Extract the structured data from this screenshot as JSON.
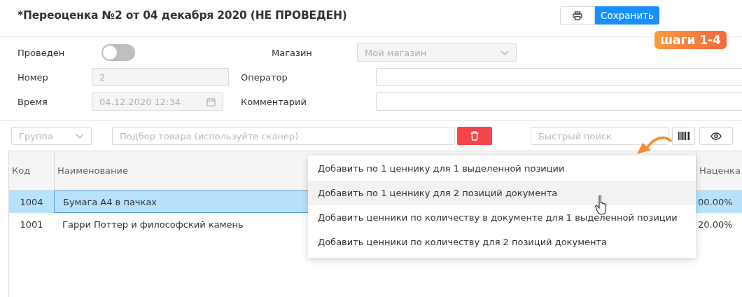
{
  "title": "*Переоценка №2 от 04 декабря 2020 (НЕ ПРОВЕДЕН)",
  "header_buttons": {
    "save": "Сохранить"
  },
  "badge": "шаги 1-4",
  "form": {
    "posted": {
      "label": "Проведен",
      "on": false
    },
    "store": {
      "label": "Магазин",
      "value": "Мой магазин",
      "disabled": true
    },
    "number": {
      "label": "Номер",
      "value": "2",
      "disabled": true
    },
    "operator": {
      "label": "Оператор"
    },
    "time": {
      "label": "Время",
      "value": "04.12.2020 12:34",
      "disabled": true
    },
    "comment": {
      "label": "Комментарий"
    }
  },
  "toolbar": {
    "group": {
      "placeholder": "Группа"
    },
    "product_filter": {
      "placeholder": "Подбор товара (используйте сканер)"
    },
    "quick_search": {
      "placeholder": "Быстрый поиск"
    }
  },
  "table": {
    "columns": [
      "Код",
      "Наименование",
      "Наценка"
    ],
    "rows": [
      {
        "code": "1004",
        "name": "Бумага А4 в пачках",
        "markup": "00.00%",
        "selected": true
      },
      {
        "code": "1001",
        "name": "Гарри Поттер и философский камень",
        "markup": "20.00%",
        "selected": false
      }
    ]
  },
  "menu": [
    {
      "label": "Добавить по 1 ценнику для 1 выделенной позиции",
      "hovered": false
    },
    {
      "label": "Добавить по 1 ценнику для 2 позиций документа",
      "hovered": true
    },
    {
      "label": "Добавить ценники по количеству в документе для 1 выделенной позиции",
      "hovered": false
    },
    {
      "label": "Добавить ценники по количеству для 2 позиций документа",
      "hovered": false
    }
  ]
}
